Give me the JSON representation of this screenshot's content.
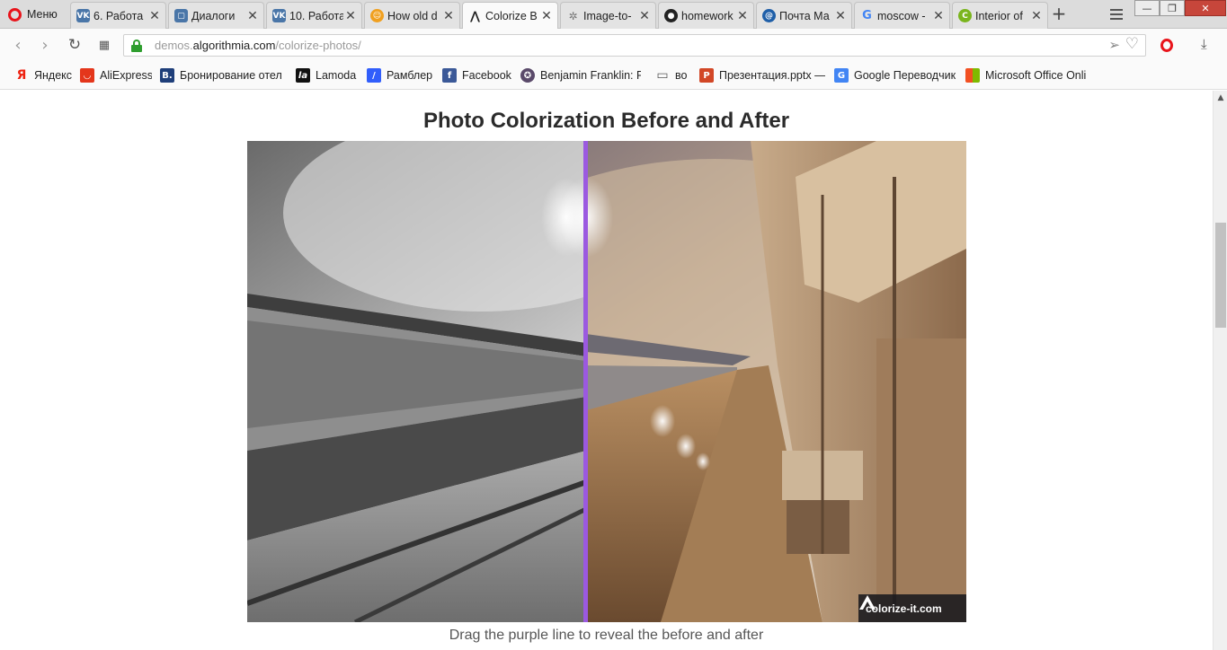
{
  "browser": {
    "menu_label": "Меню",
    "tabs": [
      {
        "title": "6. Работа",
        "icon": "vk-icon",
        "close": "✕"
      },
      {
        "title": "Диалоги",
        "icon": "vk-messages-icon",
        "close": "✕"
      },
      {
        "title": "10. Работа",
        "icon": "vk-icon",
        "close": "✕"
      },
      {
        "title": "How old d",
        "icon": "how-old-icon",
        "close": "✕"
      },
      {
        "title": "Colorize B",
        "icon": "algorithmia-icon",
        "close": "✕"
      },
      {
        "title": "Image-to-",
        "icon": "image-to-icon",
        "close": "✕"
      },
      {
        "title": "homework",
        "icon": "github-icon",
        "close": "✕"
      },
      {
        "title": "Почта Ма",
        "icon": "mail-ru-icon",
        "close": "✕"
      },
      {
        "title": "moscow -",
        "icon": "google-icon",
        "close": "✕"
      },
      {
        "title": "Interior of",
        "icon": "interior-icon",
        "close": "✕"
      }
    ],
    "new_tab": "+",
    "window_buttons": {
      "minimize": "—",
      "restore": "❐",
      "close": "✕"
    },
    "url": {
      "prefix": "demos.",
      "host": "algorithmia.com",
      "path": "/colorize-photos/"
    },
    "bookmarks": [
      {
        "label": "Яндекс",
        "icon": "yandex-icon"
      },
      {
        "label": "AliExpress",
        "icon": "aliexpress-icon"
      },
      {
        "label": "Бронирование отел",
        "icon": "booking-icon"
      },
      {
        "label": "Lamoda",
        "icon": "lamoda-icon"
      },
      {
        "label": "Рамблер",
        "icon": "rambler-icon"
      },
      {
        "label": "Facebook",
        "icon": "facebook-icon"
      },
      {
        "label": "Benjamin Franklin: Fir",
        "icon": "seal-icon"
      },
      {
        "label": "во",
        "icon": "folder-icon"
      },
      {
        "label": "Презентация.pptx —",
        "icon": "powerpoint-icon"
      },
      {
        "label": "Google Переводчик",
        "icon": "google-translate-icon"
      },
      {
        "label": "Microsoft Office Onli",
        "icon": "office-icon"
      }
    ]
  },
  "page": {
    "title": "Photo Colorization Before and After",
    "caption": "Drag the purple line to reveal the before and after",
    "watermark": "colorize-it.com",
    "divider_position": 0.47,
    "accent_color": "#9b59e0"
  }
}
